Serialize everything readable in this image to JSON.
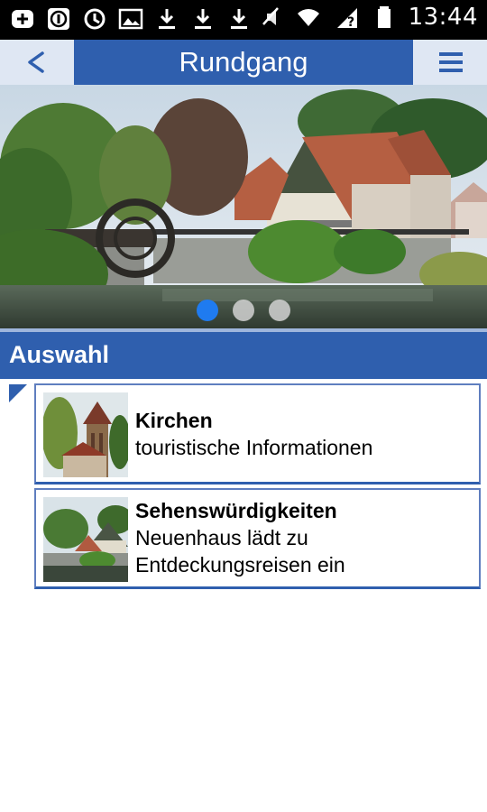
{
  "status_bar": {
    "time": "13:44",
    "icons": [
      "add-icon",
      "info-icon",
      "sync-icon",
      "image-icon",
      "download-icon",
      "download-icon",
      "download-icon",
      "sound-muted-icon",
      "wifi-icon",
      "signal-unknown-icon",
      "battery-icon"
    ]
  },
  "header": {
    "back_label": "<",
    "title": "Rundgang",
    "menu_icon": "hamburger-menu-icon"
  },
  "banner": {
    "slides_count": 3,
    "active_slide": 1
  },
  "section": {
    "label": "Auswahl"
  },
  "items": [
    {
      "title": "Kirchen",
      "subtitle": "touristische Informationen"
    },
    {
      "title": "Sehenswürdigkeiten",
      "subtitle_line1": "Neuenhaus lädt zu",
      "subtitle_line2": "Entdeckungsreisen ein"
    }
  ],
  "colors": {
    "accent": "#2f5fae",
    "header_bg": "#dfe7f3",
    "active_dot": "#1f7bf0"
  }
}
